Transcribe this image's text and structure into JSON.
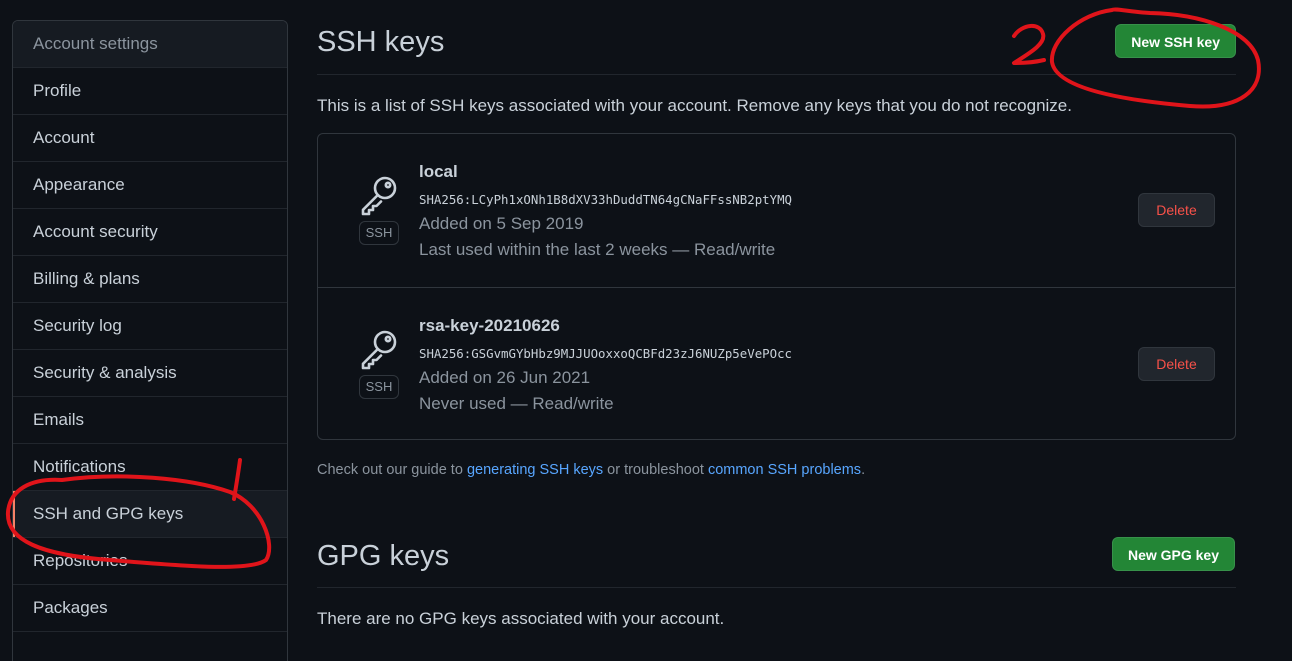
{
  "sidebar": {
    "header": "Account settings",
    "items": [
      {
        "label": "Profile"
      },
      {
        "label": "Account"
      },
      {
        "label": "Appearance"
      },
      {
        "label": "Account security"
      },
      {
        "label": "Billing & plans"
      },
      {
        "label": "Security log"
      },
      {
        "label": "Security & analysis"
      },
      {
        "label": "Emails"
      },
      {
        "label": "Notifications"
      },
      {
        "label": "SSH and GPG keys",
        "selected": true
      },
      {
        "label": "Repositories"
      },
      {
        "label": "Packages"
      }
    ]
  },
  "ssh": {
    "title": "SSH keys",
    "new_button": "New SSH key",
    "intro": "This is a list of SSH keys associated with your account. Remove any keys that you do not recognize.",
    "keys": [
      {
        "title": "local",
        "fingerprint": "SHA256:LCyPh1xONh1B8dXV33hDuddTN64gCNaFFssNB2ptYMQ",
        "added": "Added on 5 Sep 2019",
        "usage": "Last used within the last 2 weeks — Read/write",
        "badge": "SSH",
        "icon": "key-icon",
        "delete_label": "Delete"
      },
      {
        "title": "rsa-key-20210626",
        "fingerprint": "SHA256:GSGvmGYbHbz9MJJUOoxxoQCBFd23zJ6NUZp5eVePOcc",
        "added": "Added on 26 Jun 2021",
        "usage": "Never used — Read/write",
        "badge": "SSH",
        "icon": "key-icon",
        "delete_label": "Delete"
      }
    ],
    "guide": {
      "prefix": "Check out our guide to ",
      "link1": "generating SSH keys",
      "middle": " or troubleshoot ",
      "link2": "common SSH problems",
      "suffix": "."
    }
  },
  "gpg": {
    "title": "GPG keys",
    "new_button": "New GPG key",
    "empty": "There are no GPG keys associated with your account."
  },
  "annotations": {
    "mark1": "1",
    "mark2": "2",
    "color": "#e0141a"
  },
  "colors": {
    "background": "#0d1117",
    "green_button": "#238636",
    "delete_text": "#f85149",
    "link": "#58a6ff",
    "selected_indicator": "#f78166"
  }
}
